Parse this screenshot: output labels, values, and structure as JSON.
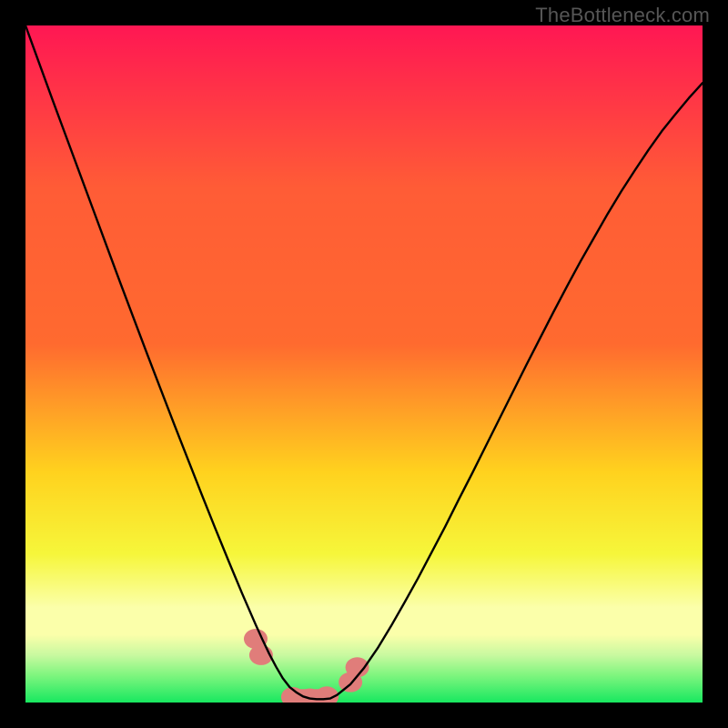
{
  "watermark": "TheBottleneck.com",
  "colors": {
    "top": "#ff1753",
    "upper_mid": "#ff6a2f",
    "mid": "#ffd21e",
    "lower_mid": "#f6f63a",
    "pale": "#fbffaa",
    "green_light": "#7ef57e",
    "green": "#18e860",
    "curve": "#000000",
    "marker": "#e07d7a"
  },
  "chart_data": {
    "type": "line",
    "title": "",
    "xlabel": "",
    "ylabel": "",
    "xlim": [
      0,
      100
    ],
    "ylim": [
      0,
      100
    ],
    "x": [
      0,
      2,
      4,
      6,
      8,
      10,
      12,
      14,
      16,
      18,
      20,
      22,
      24,
      26,
      28,
      30,
      31,
      32,
      33,
      34,
      35,
      36,
      37,
      38,
      39,
      40,
      41,
      42,
      43,
      44,
      45,
      46,
      48,
      50,
      52,
      54,
      56,
      58,
      60,
      62,
      64,
      66,
      68,
      70,
      72,
      74,
      76,
      78,
      80,
      82,
      84,
      86,
      88,
      90,
      92,
      94,
      96,
      98,
      100
    ],
    "values": [
      100,
      94.5,
      89,
      83.6,
      78.2,
      72.8,
      67.4,
      62,
      56.7,
      51.4,
      46.2,
      41,
      35.9,
      30.8,
      25.8,
      20.9,
      18.5,
      16.1,
      13.8,
      11.5,
      9.3,
      7.2,
      5.3,
      3.6,
      2.3,
      1.5,
      0.9,
      0.6,
      0.5,
      0.5,
      0.6,
      1.1,
      2.7,
      5.1,
      8.0,
      11.3,
      14.8,
      18.4,
      22.2,
      26.0,
      30.0,
      33.9,
      37.9,
      41.9,
      45.9,
      49.9,
      53.8,
      57.7,
      61.5,
      65.2,
      68.7,
      72.2,
      75.5,
      78.6,
      81.6,
      84.4,
      86.9,
      89.3,
      91.5
    ],
    "annotations": [
      {
        "shape": "blob",
        "x": 34.0,
        "y": 9.4
      },
      {
        "shape": "blob",
        "x": 34.8,
        "y": 7.0
      },
      {
        "shape": "blob",
        "x": 39.5,
        "y": 0.8
      },
      {
        "shape": "blob",
        "x": 42.0,
        "y": 0.6
      },
      {
        "shape": "blob",
        "x": 44.5,
        "y": 0.9
      },
      {
        "shape": "blob",
        "x": 48.0,
        "y": 3.0
      },
      {
        "shape": "blob",
        "x": 49.0,
        "y": 5.2
      }
    ]
  }
}
